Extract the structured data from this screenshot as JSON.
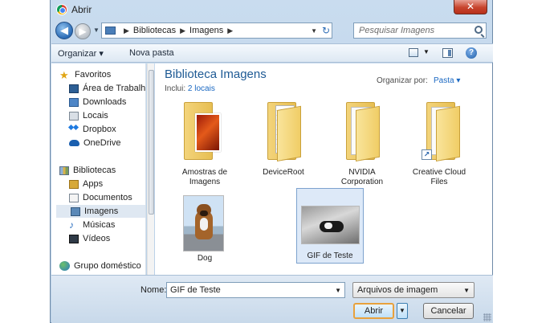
{
  "window": {
    "title": "Abrir",
    "close_label": "✕"
  },
  "address": {
    "crumbs": [
      "Bibliotecas",
      "Imagens"
    ],
    "separator": "▶"
  },
  "search": {
    "placeholder": "Pesquisar Imagens"
  },
  "toolbar": {
    "organize_label": "Organizar ▾",
    "new_folder_label": "Nova pasta",
    "help_label": "?"
  },
  "sidebar": {
    "favorites": {
      "label": "Favoritos",
      "items": [
        {
          "label": "Área de Trabalho",
          "icon": "desktop-icon"
        },
        {
          "label": "Downloads",
          "icon": "downloads-icon"
        },
        {
          "label": "Locais",
          "icon": "recent-places-icon"
        },
        {
          "label": "Dropbox",
          "icon": "dropbox-icon"
        },
        {
          "label": "OneDrive",
          "icon": "onedrive-icon"
        }
      ]
    },
    "libraries": {
      "label": "Bibliotecas",
      "items": [
        {
          "label": "Apps",
          "icon": "apps-folder-icon"
        },
        {
          "label": "Documentos",
          "icon": "documents-icon"
        },
        {
          "label": "Imagens",
          "icon": "pictures-icon",
          "selected": true
        },
        {
          "label": "Músicas",
          "icon": "music-icon"
        },
        {
          "label": "Vídeos",
          "icon": "videos-icon"
        }
      ]
    },
    "homegroup": {
      "label": "Grupo doméstico"
    }
  },
  "library": {
    "title": "Biblioteca Imagens",
    "includes_label": "Inclui:",
    "includes_link": "2 locais",
    "arrange_label": "Organizar por:",
    "arrange_value": "Pasta ▾"
  },
  "items": [
    {
      "label": "Amostras de Imagens",
      "type": "folder-with-picture"
    },
    {
      "label": "DeviceRoot",
      "type": "folder"
    },
    {
      "label": "NVIDIA Corporation",
      "type": "folder"
    },
    {
      "label": "Creative Cloud Files",
      "type": "folder-shortcut"
    },
    {
      "label": "Dog",
      "type": "image"
    },
    {
      "label": "GIF de Teste",
      "type": "image",
      "selected": true
    }
  ],
  "footer": {
    "name_label": "Nome:",
    "name_value": "GIF de Teste",
    "filetype_value": "Arquivos de imagem",
    "open_label": "Abrir",
    "cancel_label": "Cancelar"
  },
  "colors": {
    "accent_blue": "#1e5a94",
    "link_blue": "#1a68c2",
    "default_button_border": "#e8a13c",
    "selection_bg": "#dde9f8"
  }
}
